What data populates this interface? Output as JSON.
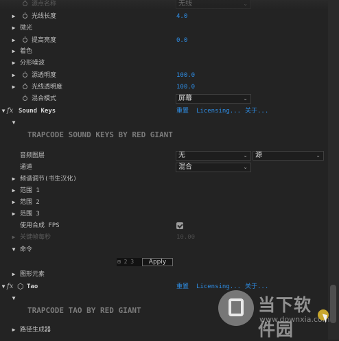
{
  "rows": {
    "r0": {
      "label": "源点名称",
      "value": "无线"
    },
    "r1": {
      "label": "光线长度",
      "value": "4.0"
    },
    "r2": {
      "label": "微光"
    },
    "r3": {
      "label": "提高亮度",
      "value": "0.0"
    },
    "r4": {
      "label": "着色"
    },
    "r5": {
      "label": "分形噪波"
    },
    "r6": {
      "label": "源透明度",
      "value": "100.0"
    },
    "r7": {
      "label": "光线透明度",
      "value": "100.0"
    },
    "r8": {
      "label": "混合模式",
      "value": "屏幕"
    }
  },
  "effect1": {
    "fx": "fx",
    "name": "Sound Keys",
    "reset": "重置",
    "licensing": "Licensing...",
    "about": "关于...",
    "banner": "TRAPCODE SOUND KEYS BY RED GIANT",
    "audio_layer": {
      "label": "音频图层",
      "value1": "无",
      "value2": "源"
    },
    "channel": {
      "label": "通道",
      "value": "混合"
    },
    "freq": {
      "label": "频谱调节(书生汉化)"
    },
    "range1": {
      "label": "范围 1"
    },
    "range2": {
      "label": "范围 2"
    },
    "range3": {
      "label": "范围 3"
    },
    "use_fps": {
      "label": "使用合成 FPS",
      "checked": true
    },
    "keyframes": {
      "label": "关键帧每秒",
      "value": "10.00"
    },
    "command": {
      "label": "命令"
    },
    "apply_icon": "⊞ 2 3",
    "apply": "Apply",
    "graphic": {
      "label": "图形元素"
    }
  },
  "effect2": {
    "fx": "fx",
    "name": "Tao",
    "reset": "重置",
    "licensing": "Licensing...",
    "about": "关于...",
    "banner": "TRAPCODE TAO BY RED GIANT",
    "path_gen": {
      "label": "路径生成器"
    }
  },
  "watermark": {
    "text": "当下软件园",
    "url": "www.downxia.com"
  },
  "icons": {
    "twirl_closed": "▶",
    "twirl_open": "▼",
    "chevron": "⌄"
  }
}
